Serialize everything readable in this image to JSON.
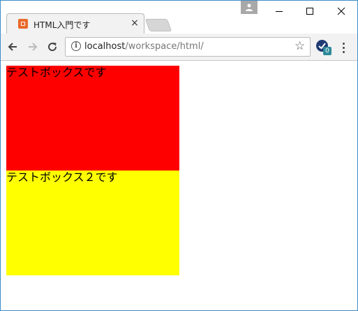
{
  "browser": {
    "tab_title": "HTML入門です",
    "tab_close": "×",
    "url_host": "localhost",
    "url_path": "/workspace/html/",
    "extension_badge": "0",
    "colors": {
      "frame_border": "#3b8cc8",
      "favicon": "#e96b2c",
      "extension": "#1f3b73"
    }
  },
  "page": {
    "boxes": [
      {
        "text": "テストボックスです",
        "color": "#ff0000"
      },
      {
        "text": "テストボックス２です",
        "color": "#ffff00"
      }
    ]
  }
}
